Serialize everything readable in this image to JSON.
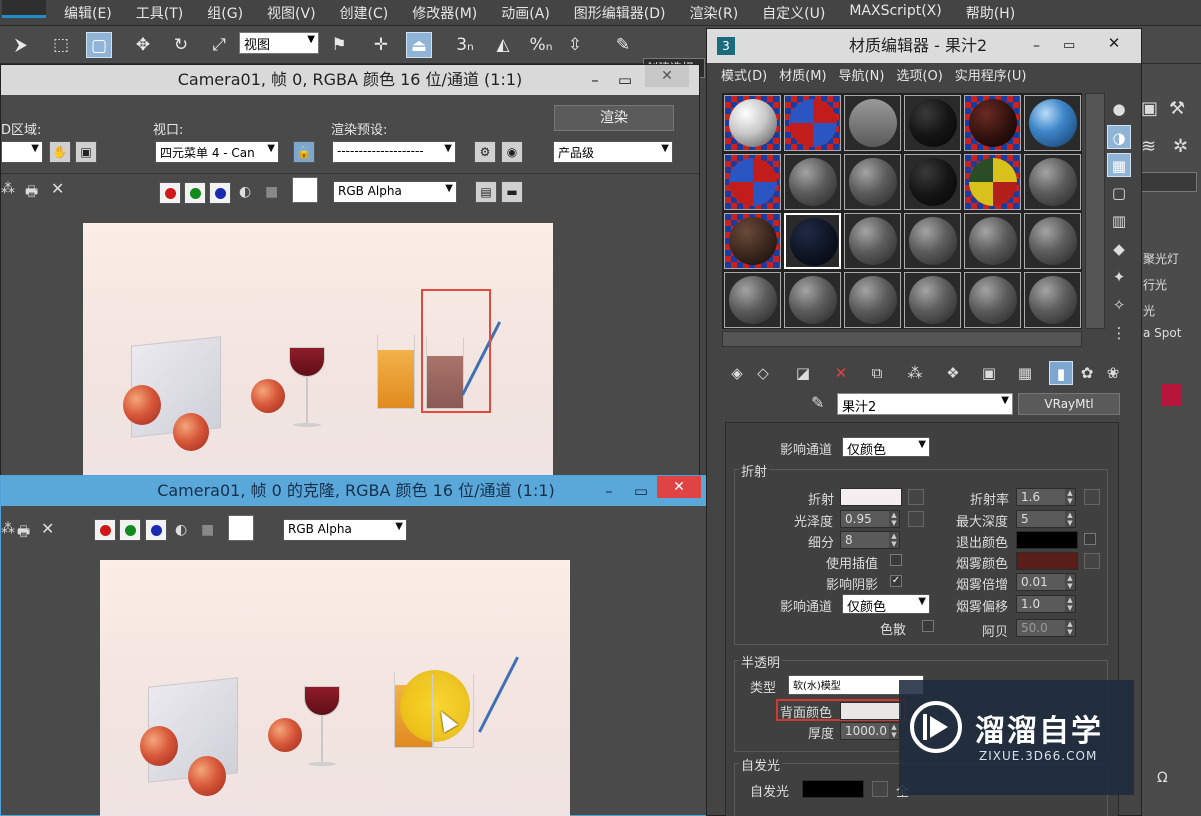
{
  "menubar": {
    "items": [
      "编辑(E)",
      "工具(T)",
      "组(G)",
      "视图(V)",
      "创建(C)",
      "修改器(M)",
      "动画(A)",
      "图形编辑器(D)",
      "渲染(R)",
      "自定义(U)",
      "MAXScript(X)",
      "帮助(H)"
    ]
  },
  "toolbar": {
    "view_dropdown": "视图",
    "snap_label": "3",
    "percent_label": "%",
    "create_selection": "创建选择"
  },
  "render1": {
    "title": "Camera01, 帧 0, RGBA 颜色 16 位/通道 (1:1)",
    "area_label": "D区域:",
    "viewport_label": "视口:",
    "viewport_value": "四元菜单 4 - Can",
    "preset_label": "渲染预设:",
    "preset_value": "--------------------",
    "render_button": "渲染",
    "quality_value": "产品级",
    "channel_value": "RGB Alpha"
  },
  "render2": {
    "title": "Camera01, 帧 0 的克隆, RGBA 颜色 16 位/通道 (1:1)",
    "channel_value": "RGB Alpha"
  },
  "material_editor": {
    "title": "材质编辑器 - 果汁2",
    "menu": [
      "模式(D)",
      "材质(M)",
      "导航(N)",
      "选项(O)",
      "实用程序(U)"
    ],
    "material_name": "果汁2",
    "material_type": "VRayMtl",
    "top_channel_label": "影响通道",
    "top_channel_value": "仅颜色",
    "refraction": {
      "group": "折射",
      "refract": "折射",
      "glossiness": "光泽度",
      "glossiness_value": "0.95",
      "subdivs": "细分",
      "subdivs_value": "8",
      "use_interp": "使用插值",
      "affect_shadows": "影响阴影",
      "affect_channel": "影响通道",
      "affect_channel_value": "仅颜色",
      "dispersion": "色散",
      "ior": "折射率",
      "ior_value": "1.6",
      "max_depth": "最大深度",
      "max_depth_value": "5",
      "exit_color": "退出颜色",
      "fog_color": "烟雾颜色",
      "fog_mult": "烟雾倍增",
      "fog_mult_value": "0.01",
      "fog_bias": "烟雾偏移",
      "fog_bias_value": "1.0",
      "abbe": "阿贝",
      "abbe_value": "50.0"
    },
    "translucency": {
      "group": "半透明",
      "type_label": "类型",
      "type_value": "软(水)模型",
      "back_color": "背面颜色",
      "thickness": "厚度",
      "thickness_value": "1000.0"
    },
    "self_illum": {
      "group": "自发光",
      "label": "自发光",
      "gi_partial": "全"
    }
  },
  "command_panel": {
    "items": [
      "聚光灯",
      "行光",
      "光",
      "a Spot"
    ]
  },
  "watermark": {
    "big": "溜溜自学",
    "small": "ZIXUE.3D66.COM"
  },
  "colors": {
    "accent": "#1e8dc8",
    "highlight_red": "#e14a3c",
    "fog_color": "#5a1e1a",
    "close_red": "#e04343"
  }
}
